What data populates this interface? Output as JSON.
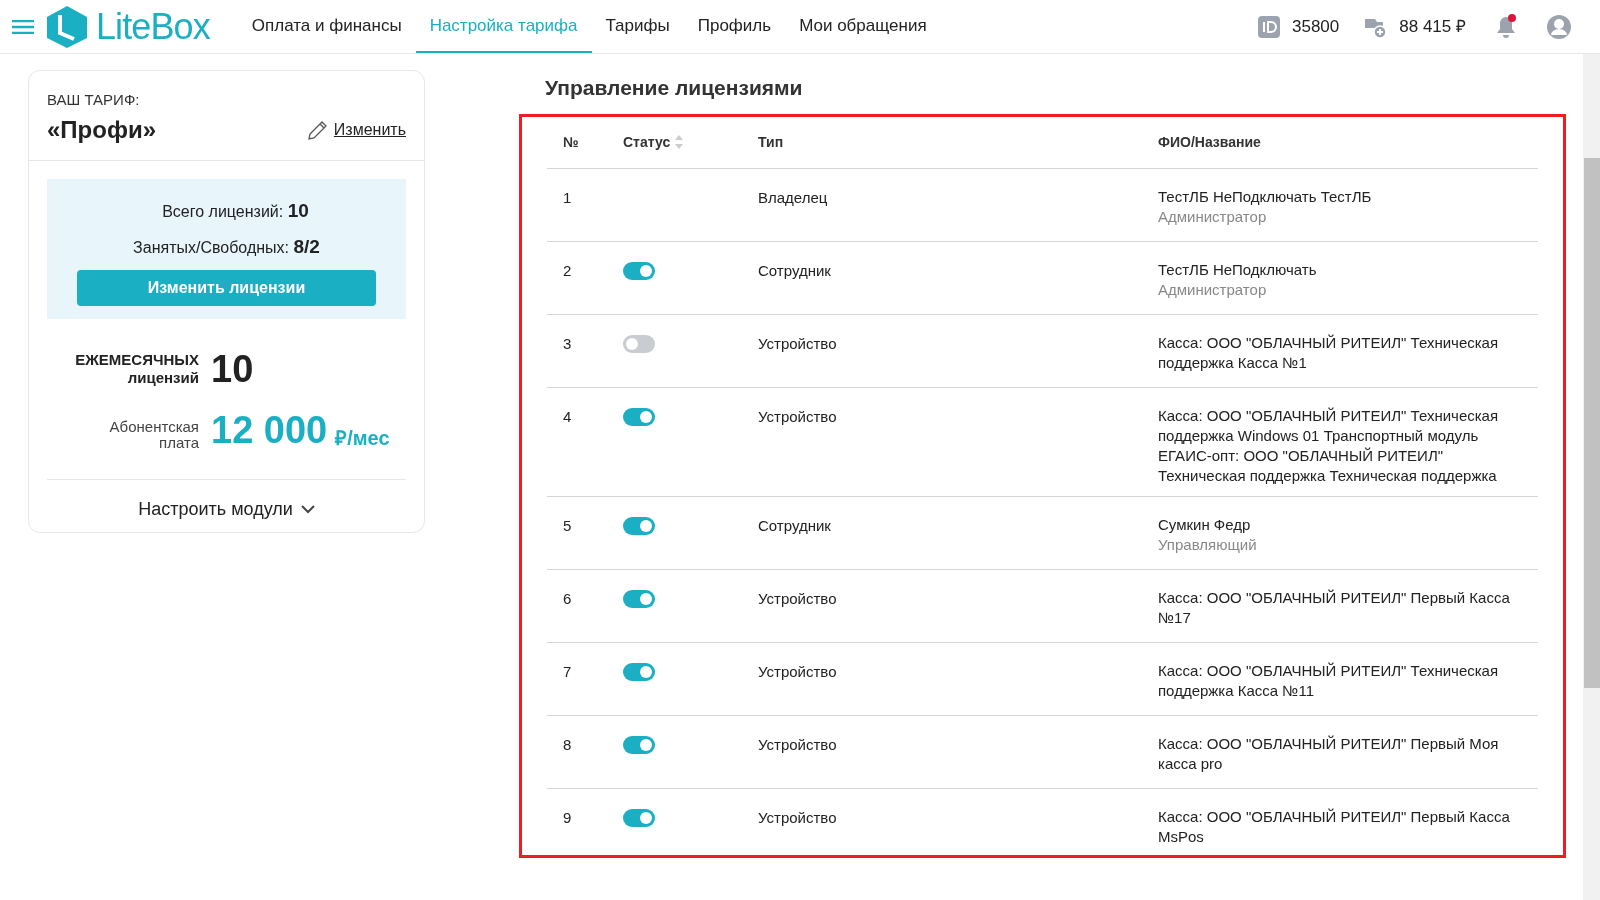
{
  "header": {
    "logo": "LiteBox",
    "nav": [
      {
        "label": "Оплата и финансы",
        "selected": false
      },
      {
        "label": "Настройка тарифа",
        "selected": true
      },
      {
        "label": "Тарифы",
        "selected": false
      },
      {
        "label": "Профиль",
        "selected": false
      },
      {
        "label": "Мои обращения",
        "selected": false
      }
    ],
    "account_id": "35800",
    "balance": "88 415 ₽",
    "notifications_unread": true
  },
  "tariff": {
    "caption": "ВАШ ТАРИФ:",
    "name": "«Профи»",
    "edit_link": "Изменить",
    "total_label": "Всего лицензий:",
    "total_value": "10",
    "used_label": "Занятых/Свободных:",
    "used_value": "8/2",
    "change_button": "Изменить лицензии",
    "monthly_label_1": "ЕЖЕМЕСЯЧНЫХ",
    "monthly_label_2": "лицензий",
    "monthly_value": "10",
    "fee_label_1": "Абонентская",
    "fee_label_2": "плата",
    "fee_value": "12 000",
    "fee_unit": "₽/мес",
    "modules_button": "Настроить модули"
  },
  "licenses": {
    "title": "Управление лицензиями",
    "highlighted": true,
    "columns": [
      "№",
      "Статус",
      "Тип",
      "ФИО/Название"
    ],
    "rows": [
      {
        "no": "1",
        "type": "Владелец",
        "name": "ТестЛБ НеПодключать ТестЛБ",
        "role": "Администратор"
      },
      {
        "no": "2",
        "on": true,
        "type": "Сотрудник",
        "name": "ТестЛБ НеПодключать",
        "role": "Администратор"
      },
      {
        "no": "3",
        "on": false,
        "type": "Устройство",
        "name": "Касса: ООО \"ОБЛАЧНЫЙ РИТЕИЛ\" Техническая поддержка Касса №1"
      },
      {
        "no": "4",
        "on": true,
        "type": "Устройство",
        "name": "Касса: ООО \"ОБЛАЧНЫЙ РИТЕИЛ\" Техническая поддержка Windows 01 Транспортный модуль ЕГАИС-опт: ООО \"ОБЛАЧНЫЙ РИТЕИЛ\" Техническая поддержка Техническая поддержка"
      },
      {
        "no": "5",
        "on": true,
        "type": "Сотрудник",
        "name": "Сумкин Федр",
        "role": "Управляющий"
      },
      {
        "no": "6",
        "on": true,
        "type": "Устройство",
        "name": "Касса: ООО \"ОБЛАЧНЫЙ РИТЕИЛ\" Первый Касса №17"
      },
      {
        "no": "7",
        "on": true,
        "type": "Устройство",
        "name": "Касса: ООО \"ОБЛАЧНЫЙ РИТЕИЛ\" Техническая поддержка Касса №11"
      },
      {
        "no": "8",
        "on": true,
        "type": "Устройство",
        "name": "Касса: ООО \"ОБЛАЧНЫЙ РИТЕИЛ\" Первый Моя касса pro"
      },
      {
        "no": "9",
        "on": true,
        "type": "Устройство",
        "name": "Касса: ООО \"ОБЛАЧНЫЙ РИТЕИЛ\" Первый Касса MsPos"
      }
    ]
  }
}
